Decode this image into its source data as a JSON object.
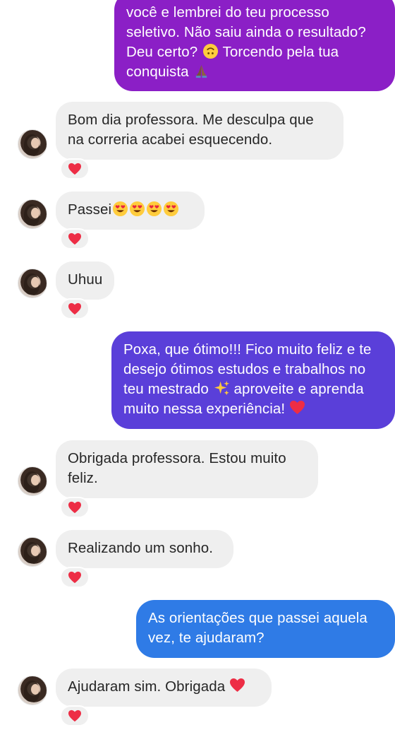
{
  "conversation": {
    "messages": [
      {
        "direction": "outgoing",
        "text_lines": [
          "você e lembrei do teu processo",
          "seletivo. Não saiu ainda o resultado?",
          "Deu certo?",
          " Torcendo pela tua",
          "conquista"
        ],
        "emojis": [
          "upside-down-face-emoji",
          "pray-emoji"
        ]
      },
      {
        "direction": "incoming",
        "text": "Bom dia professora. Me desculpa que na correria acabei esquecendo.",
        "reaction": "heart-icon"
      },
      {
        "direction": "incoming",
        "text": "Passei",
        "emojis": [
          "heart-eyes-emoji",
          "heart-eyes-emoji",
          "heart-eyes-emoji",
          "heart-eyes-emoji"
        ],
        "reaction": "heart-icon"
      },
      {
        "direction": "incoming",
        "text": "Uhuu",
        "reaction": "heart-icon"
      },
      {
        "direction": "outgoing",
        "text_a": "Poxa, que ótimo!!! Fico muito feliz e te desejo ótimos estudos e trabalhos no teu mestrado",
        "text_b": " aproveite e aprenda muito nessa experiência!",
        "emojis": [
          "sparkles-emoji",
          "heart-emoji"
        ]
      },
      {
        "direction": "incoming",
        "text": "Obrigada professora. Estou muito feliz.",
        "reaction": "heart-icon"
      },
      {
        "direction": "incoming",
        "text": "Realizando um sonho.",
        "reaction": "heart-icon"
      },
      {
        "direction": "outgoing",
        "text": "As orientações que passei aquela vez, te ajudaram?"
      },
      {
        "direction": "incoming",
        "text": "Ajudaram sim. Obrigada",
        "emojis": [
          "heart-emoji"
        ],
        "reaction": "heart-icon"
      }
    ]
  },
  "colors": {
    "incoming_bubble": "#efefef",
    "incoming_text": "#262626",
    "outgoing_text": "#ffffff",
    "gradient_purple": "#8b1fc6",
    "gradient_indigo": "#5a3fd9",
    "gradient_blue": "#2f7be6",
    "heart_red": "#ed2d45"
  }
}
